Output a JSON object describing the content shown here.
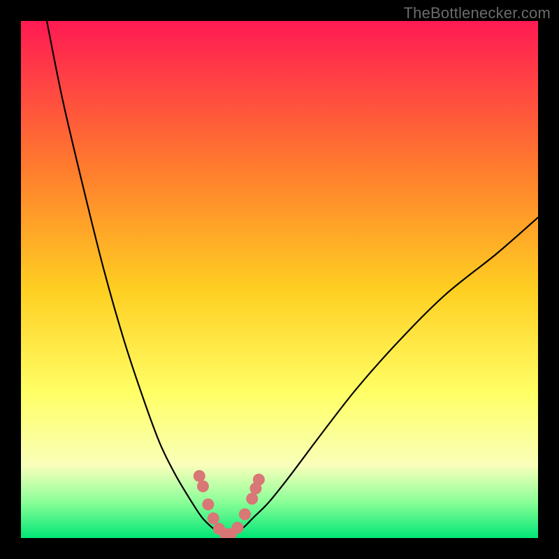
{
  "watermark": "TheBottlenecker.com",
  "colors": {
    "bg_frame": "#000000",
    "gradient_top": "#ff1a53",
    "gradient_mid1": "#ff7a2e",
    "gradient_mid2": "#ffcf22",
    "gradient_mid3": "#ffff66",
    "gradient_low1": "#f9ffba",
    "gradient_low2": "#8cff98",
    "gradient_bottom": "#00e676",
    "curve": "#000000",
    "marker_fill": "#d97676",
    "marker_stroke": "#c35a5a"
  },
  "chart_data": {
    "type": "line",
    "title": "",
    "xlabel": "",
    "ylabel": "",
    "xlim": [
      0,
      100
    ],
    "ylim": [
      0,
      100
    ],
    "grid": false,
    "legend": false,
    "series": [
      {
        "name": "left-branch",
        "x": [
          5,
          8,
          12,
          16,
          20,
          24,
          27,
          30,
          33,
          35,
          37,
          38.5
        ],
        "y": [
          100,
          85,
          68,
          52,
          38,
          26,
          18,
          12,
          7,
          4,
          2,
          1
        ]
      },
      {
        "name": "right-branch",
        "x": [
          41.5,
          43,
          45,
          48,
          52,
          58,
          65,
          73,
          82,
          92,
          100
        ],
        "y": [
          1,
          2,
          4,
          7,
          12,
          20,
          29,
          38,
          47,
          55,
          62
        ]
      },
      {
        "name": "valley-floor",
        "x": [
          38.5,
          39.5,
          40.5,
          41.5
        ],
        "y": [
          1,
          0.5,
          0.5,
          1
        ]
      }
    ],
    "markers": {
      "name": "highlight-dots",
      "approx_color": "#d97676",
      "points": [
        {
          "x": 34.5,
          "y": 12
        },
        {
          "x": 35.2,
          "y": 10
        },
        {
          "x": 36.2,
          "y": 6.5
        },
        {
          "x": 37.2,
          "y": 3.8
        },
        {
          "x": 38.3,
          "y": 1.8
        },
        {
          "x": 39.5,
          "y": 0.8
        },
        {
          "x": 40.6,
          "y": 0.8
        },
        {
          "x": 41.9,
          "y": 2.0
        },
        {
          "x": 43.3,
          "y": 4.6
        },
        {
          "x": 44.7,
          "y": 7.6
        },
        {
          "x": 45.4,
          "y": 9.6
        },
        {
          "x": 46.0,
          "y": 11.3
        }
      ]
    }
  }
}
